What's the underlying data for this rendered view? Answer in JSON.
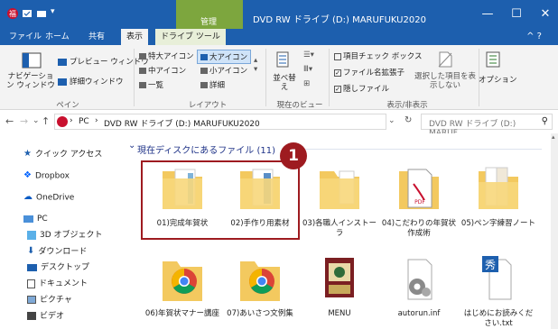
{
  "titlebar": {
    "context_group": "管理",
    "title": "DVD RW ドライブ (D:) MARUFUKU2020",
    "minimize": "—",
    "maximize": "☐",
    "close": "✕"
  },
  "ribbon_tabs": [
    "ファイル",
    "ホーム",
    "共有",
    "表示",
    "ドライブ ツール"
  ],
  "help": "^ ?",
  "ribbon": {
    "pane_group": "ペイン",
    "nav_pane": "ナビゲーション ウィンドウ",
    "preview_pane": "プレビュー ウィンドウ",
    "details_pane": "詳細ウィンドウ",
    "layout_group": "レイアウト",
    "layout_items": [
      "特大アイコン",
      "大アイコン",
      "中アイコン",
      "小アイコン",
      "一覧",
      "詳細"
    ],
    "current_view_group": "現在のビュー",
    "sort": "並べ替え",
    "showhide_group": "表示/非表示",
    "item_checkbox": "項目チェック ボックス",
    "file_ext": "ファイル名拡張子",
    "hidden_files": "隠しファイル",
    "hide_selected": "選択した項目を表示しない",
    "options": "オプション"
  },
  "address": {
    "back": "←",
    "forward": "→",
    "recent": "⌄",
    "up": "↑",
    "path_pc": "PC",
    "path_drive": "DVD RW ドライブ (D:) MARUFUKU2020",
    "search_placeholder": "DVD RW ドライブ (D:) MARUF...",
    "refresh": "↻"
  },
  "sidebar": {
    "items": [
      "クイック アクセス",
      "Dropbox",
      "OneDrive",
      "PC",
      "3D オブジェクト",
      "ダウンロード",
      "デスクトップ",
      "ドキュメント",
      "ピクチャ",
      "ビデオ"
    ]
  },
  "content": {
    "group_header": "現在ディスクにあるファイル (11)",
    "badge": "1",
    "files": [
      "01)完成年賀状",
      "02)手作り用素材",
      "03)各職人インストーラ",
      "04)こだわりの年賀状作成術",
      "05)ペン字練習ノート",
      "06)年賀状マナー講座",
      "07)あいさつ文例集",
      "MENU",
      "autorun.inf",
      "はじめにお読みください.txt"
    ]
  },
  "colors": {
    "titlebar": "#1d5fae",
    "context_tab": "#7da63e",
    "highlight": "#9e1b20",
    "folder": "#f3c95f"
  }
}
